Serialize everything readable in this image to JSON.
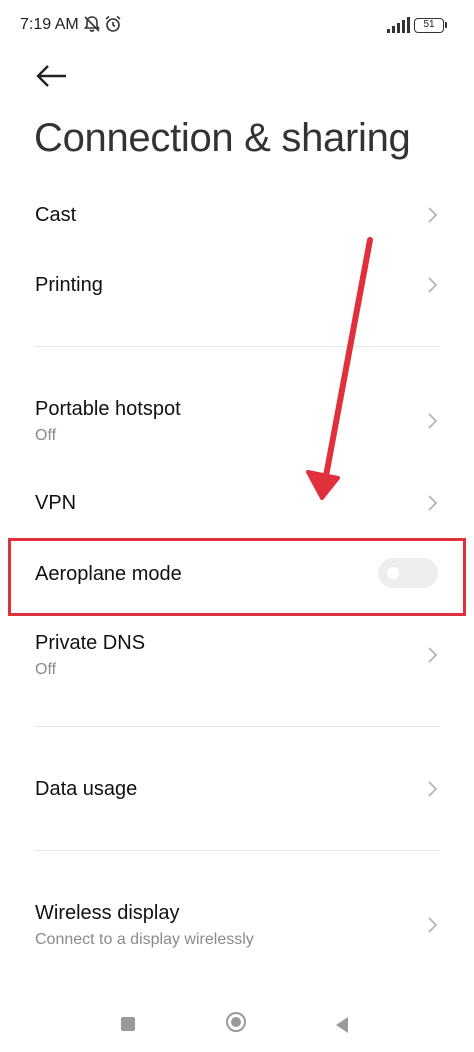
{
  "status_bar": {
    "time": "7:19 AM",
    "battery": "51",
    "icons": [
      "bell-off-icon",
      "alarm-icon",
      "signal-icon",
      "battery-icon"
    ]
  },
  "header": {
    "back_icon": "arrow-left-icon",
    "title": "Connection & sharing"
  },
  "items": [
    {
      "title": "Cast",
      "subtitle": "",
      "control": "chevron"
    },
    {
      "title": "Printing",
      "subtitle": "",
      "control": "chevron"
    },
    {
      "title": "Portable hotspot",
      "subtitle": "Off",
      "control": "chevron"
    },
    {
      "title": "VPN",
      "subtitle": "",
      "control": "chevron"
    },
    {
      "title": "Aeroplane mode",
      "subtitle": "",
      "control": "toggle",
      "toggle_on": false
    },
    {
      "title": "Private DNS",
      "subtitle": "Off",
      "control": "chevron"
    },
    {
      "title": "Data usage",
      "subtitle": "",
      "control": "chevron"
    },
    {
      "title": "Wireless display",
      "subtitle": "Connect to a display wirelessly",
      "control": "chevron"
    }
  ],
  "annotation": {
    "color": "#e0303b",
    "highlight_target": "Aeroplane mode"
  },
  "nav_bar": {
    "icons": [
      "recents-square-icon",
      "home-circle-icon",
      "back-triangle-icon"
    ]
  },
  "colors": {
    "text_primary": "#111111",
    "text_secondary": "#8a8a8a",
    "divider": "#e6e6e6",
    "toggle_off": "#eeeeee"
  }
}
